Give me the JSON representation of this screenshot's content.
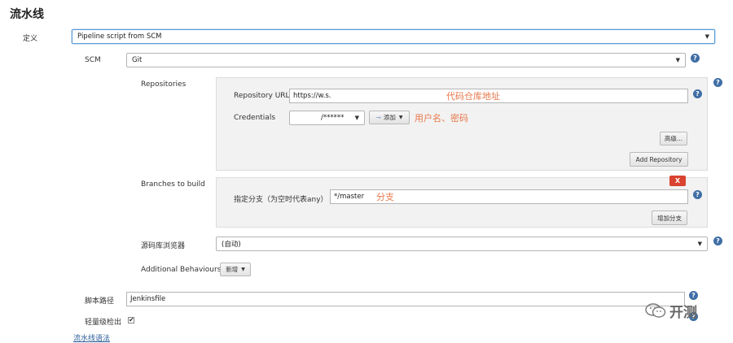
{
  "section_title": "流水线",
  "definition": {
    "label": "定义",
    "value": "Pipeline script from SCM"
  },
  "scm": {
    "label": "SCM",
    "value": "Git"
  },
  "repositories": {
    "label": "Repositories",
    "url_label": "Repository URL",
    "url_value": "https://w.s.",
    "url_note": "代码仓库地址",
    "credentials_label": "Credentials",
    "credentials_value": "/******",
    "add_button": "添加",
    "credentials_note": "用户名、密码",
    "advanced_button": "高级...",
    "add_repository_button": "Add Repository"
  },
  "branches": {
    "label": "Branches to build",
    "remove_button": "X",
    "spec_label": "指定分支（为空时代表any）",
    "spec_value": "*/master",
    "spec_note": "分支",
    "add_branch_button": "增加分支"
  },
  "browser": {
    "label": "源码库浏览器",
    "value": "(自动)"
  },
  "behaviours": {
    "label": "Additional Behaviours",
    "add_button": "新增"
  },
  "script_path": {
    "label": "脚本路径",
    "value": "Jenkinsfile"
  },
  "lightweight": {
    "label": "轻量级检出",
    "checked": true,
    "check_glyph": "✔"
  },
  "syntax_link": "流水线语法",
  "help_glyph": "?",
  "watermark": "开测"
}
